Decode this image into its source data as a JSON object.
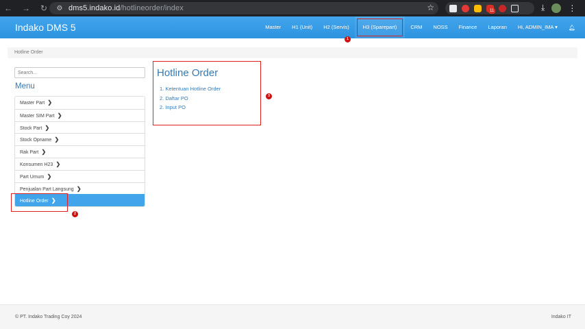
{
  "browser": {
    "url_host": "dms5.indako.id",
    "url_path": "/hotlineorder/index",
    "extensions": [
      "cube-ext",
      "adblock-ext",
      "keep-ext",
      "mail-ext",
      "shield-ext"
    ],
    "mail_badge": "11"
  },
  "navbar": {
    "brand": "Indako DMS 5",
    "items": [
      "Master",
      "H1 (Unit)",
      "H2 (Servis)",
      "H3 (Sparepart)",
      "CRM",
      "NOSS",
      "Finance",
      "Laporan",
      "Hi, ADMIN_IMA ▾"
    ],
    "active_index": 3
  },
  "breadcrumb": {
    "current": "Hotline Order"
  },
  "sidebar": {
    "search_placeholder": "Search...",
    "menu_title": "Menu",
    "items": [
      {
        "label": "Master Part"
      },
      {
        "label": "Master SIM Part"
      },
      {
        "label": "Stock Part"
      },
      {
        "label": "Stock Opname"
      },
      {
        "label": "Rak Part"
      },
      {
        "label": "Konsumen H23"
      },
      {
        "label": "Part Umum"
      },
      {
        "label": "Penjualan Part Langsung"
      },
      {
        "label": "Hotline Order"
      }
    ],
    "active_index": 8
  },
  "content": {
    "title": "Hotline Order",
    "links": [
      "1. Ketentuan Hotline Order",
      "2. Daftar PO",
      "2. Input PO"
    ]
  },
  "markers": [
    "1",
    "2",
    "3"
  ],
  "colors": {
    "navbar": "#2e93e0",
    "link": "#337ab7",
    "highlight": "#e02020"
  },
  "footer": {
    "left": "© PT. Indako Trading Coy 2024",
    "right": "Indako IT"
  }
}
